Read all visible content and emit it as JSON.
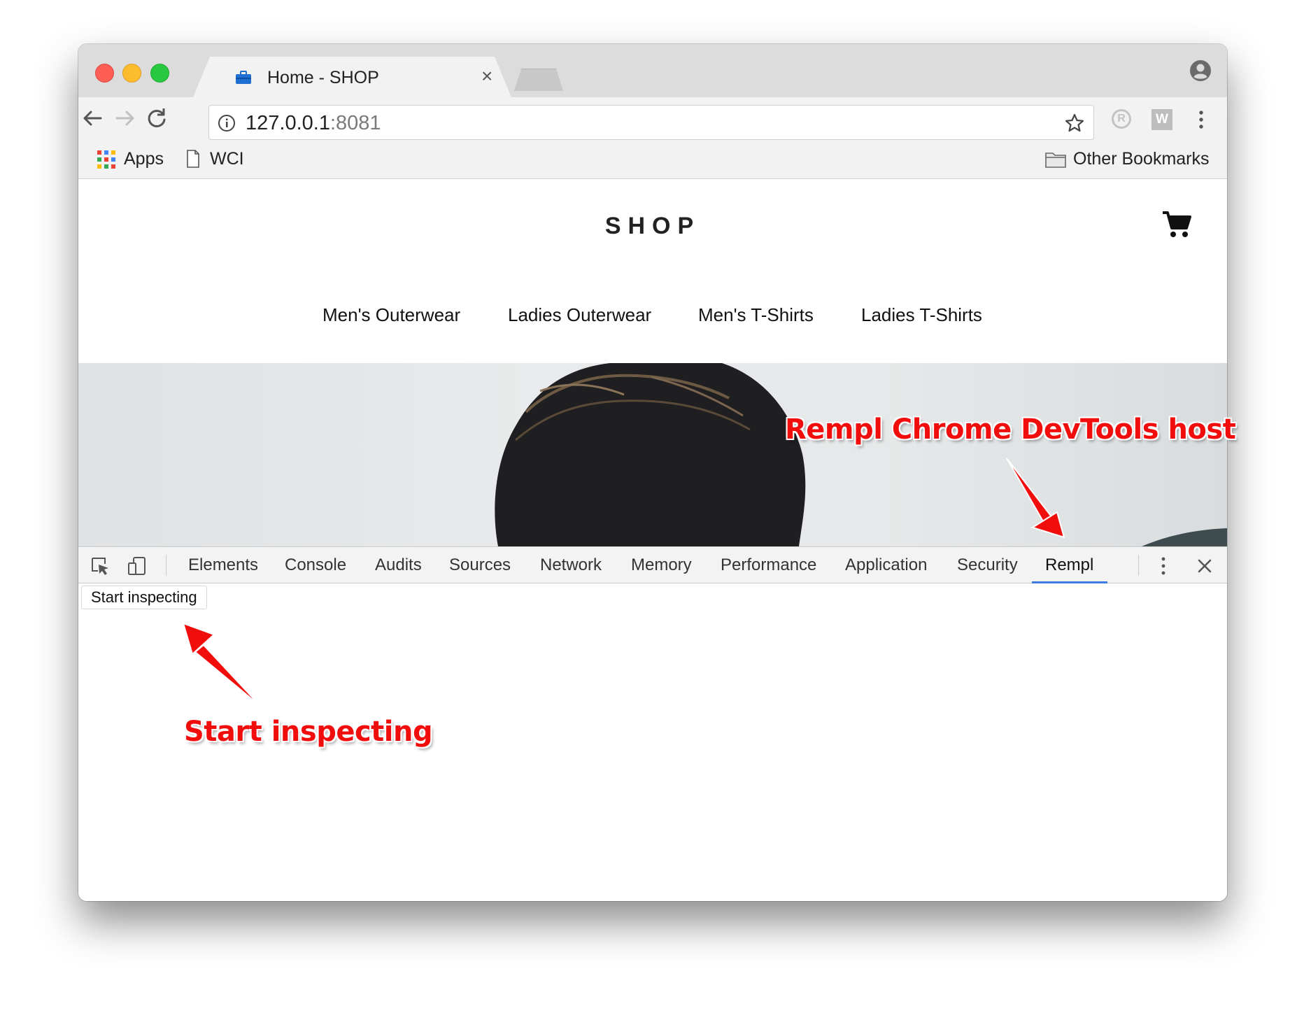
{
  "browser": {
    "tab": {
      "title": "Home - SHOP",
      "close_glyph": "×"
    },
    "address": {
      "host": "127.0.0.1",
      "port": ":8081"
    },
    "extensions": {
      "r_label": "R",
      "w_label": "W"
    },
    "bookmarks": {
      "apps": "Apps",
      "wci": "WCI",
      "other": "Other Bookmarks"
    }
  },
  "page": {
    "title": "SHOP",
    "nav": [
      "Men's Outerwear",
      "Ladies Outerwear",
      "Men's T-Shirts",
      "Ladies T-Shirts"
    ]
  },
  "devtools": {
    "tabs": [
      "Elements",
      "Console",
      "Audits",
      "Sources",
      "Network",
      "Memory",
      "Performance",
      "Application",
      "Security",
      "Rempl"
    ],
    "active_tab": "Rempl",
    "start_button": "Start inspecting"
  },
  "annotations": {
    "host": "Rempl Chrome DevTools host",
    "inspect": "Start inspecting"
  },
  "colors": {
    "annotation": "#f20d0d",
    "active_tab_underline": "#3c7ce0"
  }
}
